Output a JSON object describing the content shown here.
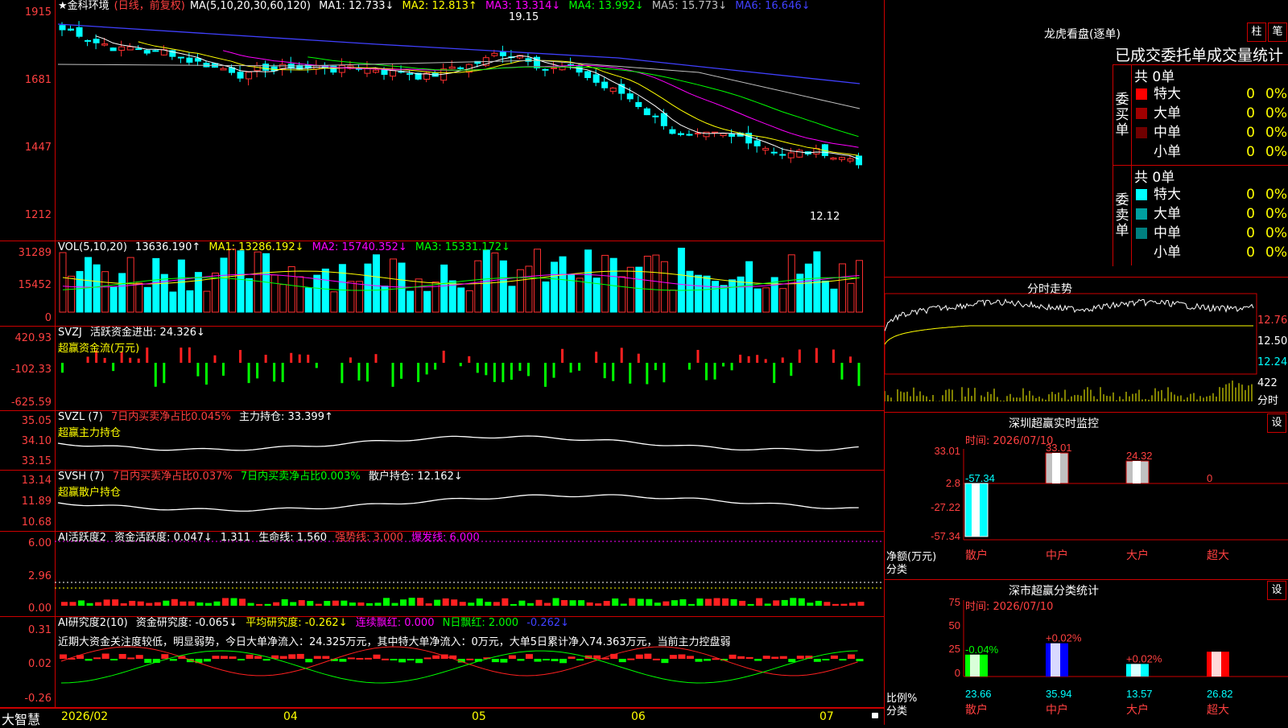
{
  "kline": {
    "stock_name": "★金科环境",
    "period_label": "(日线，前复权)",
    "ma_params": "MA(5,10,20,30,60,120)",
    "ma": [
      {
        "label": "MA1: 12.733↓",
        "color": "#ffffff"
      },
      {
        "label": "MA2: 12.813↑",
        "color": "#ffff00"
      },
      {
        "label": "MA3: 13.314↓",
        "color": "#ff00ff"
      },
      {
        "label": "MA4: 13.992↓",
        "color": "#00ff00"
      },
      {
        "label": "MA5: 15.773↓",
        "color": "#c0c0c0"
      },
      {
        "label": "MA6: 16.646↓",
        "color": "#4040ff"
      }
    ],
    "y_labels": [
      "1915",
      "1681",
      "1447",
      "1212"
    ],
    "high_label": "19.15",
    "low_label": "12.12"
  },
  "volume": {
    "title": "VOL(5,10,20)",
    "value": "13636.190↑",
    "ma": [
      {
        "label": "MA1: 13286.192↓",
        "color": "#ffff00"
      },
      {
        "label": "MA2: 15740.352↓",
        "color": "#ff00ff"
      },
      {
        "label": "MA3: 15331.172↓",
        "color": "#00ff00"
      }
    ],
    "y_labels": [
      "31289",
      "15452",
      "0"
    ]
  },
  "svzj": {
    "title": "SVZJ",
    "item": "活跃资金进出: 24.326↓",
    "subtitle": "超赢资金流(万元)",
    "y_labels": [
      "420.93",
      "-102.33",
      "-625.59"
    ]
  },
  "svzl": {
    "title": "SVZL (7)",
    "item1": "7日内买卖净占比0.045%",
    "item2": "主力持仓: 33.399↑",
    "subtitle": "超赢主力持仓",
    "y_labels": [
      "35.05",
      "34.10",
      "33.15"
    ]
  },
  "svsh": {
    "title": "SVSH (7)",
    "item1": "7日内买卖净占比0.037%",
    "item2": "7日内买卖净占比0.003%",
    "item3": "散户持仓: 12.162↓",
    "subtitle": "超赢散户持仓",
    "y_labels": [
      "13.14",
      "11.89",
      "10.68"
    ]
  },
  "ai_activity": {
    "title": "AI活跃度2",
    "item1": "资金活跃度: 0.047↓",
    "item2": "1.311",
    "item3": "生命线: 1.560",
    "item4": "强势线: 3.000",
    "item5": "爆发线: 6.000",
    "y_labels": [
      "6.00",
      "2.96",
      "0.00"
    ]
  },
  "ai_research": {
    "title": "AI研究度2(10)",
    "item1": "资金研究度: -0.065↓",
    "item2": "平均研究度: -0.262↓",
    "item3": "连续飘红: 0.000",
    "item4": "N日飘红: 2.000",
    "item5": "-0.262↓",
    "note": "近期大资金关注度较低，明显弱势，今日大单净流入：24.325万元，其中特大单净流入：0万元，大单5日累计净入74.363万元，当前主力控盘弱",
    "y_labels": [
      "0.31",
      "0.02",
      "-0.26"
    ]
  },
  "xaxis": {
    "brand": "大智慧",
    "labels": [
      "2026/02",
      "04",
      "05",
      "06",
      "07"
    ]
  },
  "longhu": {
    "title": "龙虎看盘(逐单)",
    "btn_zhu": "柱",
    "btn_bi": "笔",
    "tabs": "已成交委托单成交量统计",
    "buy_label": "委买单",
    "sell_label": "委卖单",
    "buy_total": "共 0单",
    "sell_total": "共 0单",
    "buy_rows": [
      {
        "name": "特大",
        "count": "0",
        "pct": "0%",
        "color": "#ff0000"
      },
      {
        "name": "大单",
        "count": "0",
        "pct": "0%",
        "color": "#a00000"
      },
      {
        "name": "中单",
        "count": "0",
        "pct": "0%",
        "color": "#700000"
      },
      {
        "name": "小单",
        "count": "0",
        "pct": "0%",
        "color": "#000000"
      }
    ],
    "sell_rows": [
      {
        "name": "特大",
        "count": "0",
        "pct": "0%",
        "color": "#00ffff"
      },
      {
        "name": "大单",
        "count": "0",
        "pct": "0%",
        "color": "#00a0a0"
      },
      {
        "name": "中单",
        "count": "0",
        "pct": "0%",
        "color": "#008080"
      },
      {
        "name": "小单",
        "count": "0",
        "pct": "0%",
        "color": "#000000"
      }
    ]
  },
  "intraday": {
    "title": "分时走势",
    "price_labels": [
      "12.76",
      "12.50",
      "12.24"
    ],
    "vol_label": "422",
    "vol_unit": "分时"
  },
  "sz_monitor": {
    "title": "深圳超赢实时监控",
    "btn": "设",
    "time": "时间: 2026/07/10",
    "y_labels": [
      "33.01",
      "2.8",
      "-27.22",
      "-57.34"
    ],
    "ylabel": "净额(万元)",
    "xlabel": "分类",
    "categories": [
      "散户",
      "中户",
      "大户",
      "超大"
    ],
    "values": [
      "-57.34",
      "33.01",
      "24.32",
      "0"
    ]
  },
  "sz_class": {
    "title": "深市超赢分类统计",
    "btn": "设",
    "time": "时间: 2026/07/10",
    "y_labels": [
      "75",
      "50",
      "25",
      "0"
    ],
    "ylabel": "比例%",
    "xlabel": "分类",
    "categories": [
      "散户",
      "中户",
      "大户",
      "超大"
    ],
    "values": [
      "23.66",
      "35.94",
      "13.57",
      "26.82"
    ],
    "changes": [
      "-0.04%",
      "+0.02%",
      "+0.02%",
      ""
    ]
  }
}
